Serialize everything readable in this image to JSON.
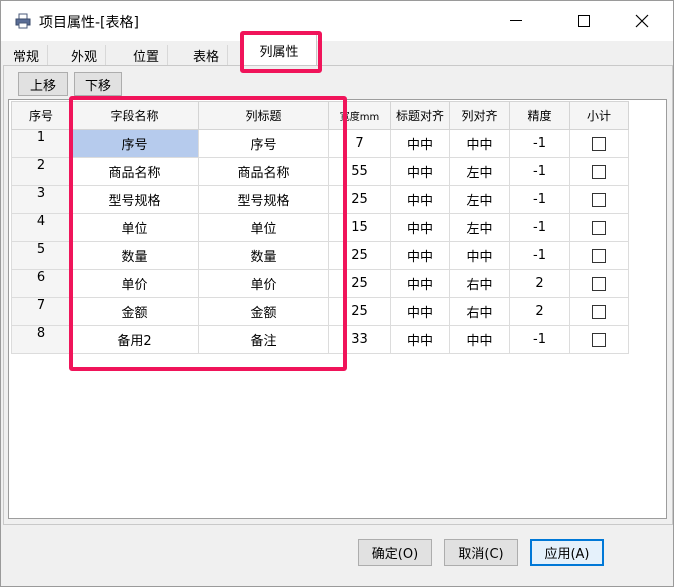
{
  "window": {
    "title": "项目属性-[表格]",
    "icon": "printer-icon"
  },
  "tabs": [
    {
      "label": "常规"
    },
    {
      "label": "外观"
    },
    {
      "label": "位置"
    },
    {
      "label": "表格"
    },
    {
      "label": "列属性",
      "active": true
    }
  ],
  "toolbar": {
    "move_up": "上移",
    "move_down": "下移"
  },
  "grid": {
    "headers": [
      "序号",
      "字段名称",
      "列标题",
      "宽度mm",
      "标题对齐",
      "列对齐",
      "精度",
      "小计"
    ],
    "rows": [
      {
        "no": "1",
        "field": "序号",
        "title": "序号",
        "width": "7",
        "title_align": "中中",
        "col_align": "中中",
        "precision": "-1",
        "subtotal": false
      },
      {
        "no": "2",
        "field": "商品名称",
        "title": "商品名称",
        "width": "55",
        "title_align": "中中",
        "col_align": "左中",
        "precision": "-1",
        "subtotal": false
      },
      {
        "no": "3",
        "field": "型号规格",
        "title": "型号规格",
        "width": "25",
        "title_align": "中中",
        "col_align": "左中",
        "precision": "-1",
        "subtotal": false
      },
      {
        "no": "4",
        "field": "单位",
        "title": "单位",
        "width": "15",
        "title_align": "中中",
        "col_align": "左中",
        "precision": "-1",
        "subtotal": false
      },
      {
        "no": "5",
        "field": "数量",
        "title": "数量",
        "width": "25",
        "title_align": "中中",
        "col_align": "中中",
        "precision": "-1",
        "subtotal": false
      },
      {
        "no": "6",
        "field": "单价",
        "title": "单价",
        "width": "25",
        "title_align": "中中",
        "col_align": "右中",
        "precision": "2",
        "subtotal": false
      },
      {
        "no": "7",
        "field": "金额",
        "title": "金额",
        "width": "25",
        "title_align": "中中",
        "col_align": "右中",
        "precision": "2",
        "subtotal": false
      },
      {
        "no": "8",
        "field": "备用2",
        "title": "备注",
        "width": "33",
        "title_align": "中中",
        "col_align": "中中",
        "precision": "-1",
        "subtotal": false
      }
    ]
  },
  "footer": {
    "ok": "确定(O)",
    "cancel": "取消(C)",
    "apply": "应用(A)"
  },
  "colors": {
    "highlight": "#f0145a",
    "selected_cell": "#b6cbed"
  }
}
